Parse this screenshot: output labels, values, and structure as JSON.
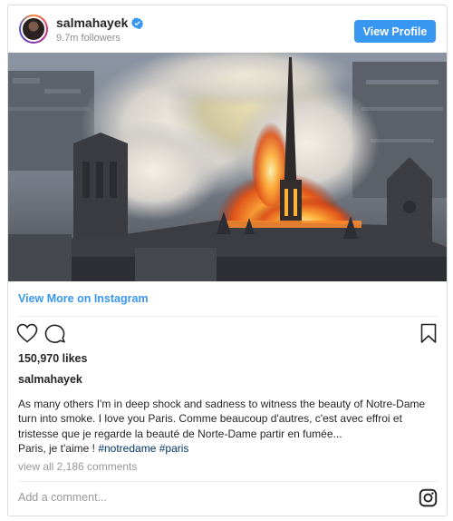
{
  "post": {
    "username": "salmahayek",
    "followers": "9.7m followers",
    "view_profile_label": "View Profile",
    "view_more_label": "View More on Instagram",
    "likes": "150,970 likes",
    "author": "salmahayek",
    "caption_line1": "As many others I'm in deep shock and sadness to witness the beauty of Notre-Dame turn into smoke. I love you Paris. Comme beaucoup d'autres, c'est avec effroi et tristesse que je regarde la beauté de Norte-Dame partir en fumée...",
    "caption_line2_text": "Paris, je t'aime ! ",
    "hashtag1": "#notredame",
    "hashtag2": "#paris",
    "view_all_comments": "view all 2,186 comments",
    "comment_placeholder": "Add a comment..."
  },
  "icons": {
    "like": "heart-outline-icon",
    "comment": "speech-bubble-icon",
    "save": "bookmark-outline-icon",
    "verified": "verified-badge-icon",
    "logo": "instagram-glyph-icon"
  },
  "colors": {
    "accent": "#3897f0",
    "hashtag": "#003569",
    "muted": "#999999",
    "border": "#dbdbdb"
  }
}
